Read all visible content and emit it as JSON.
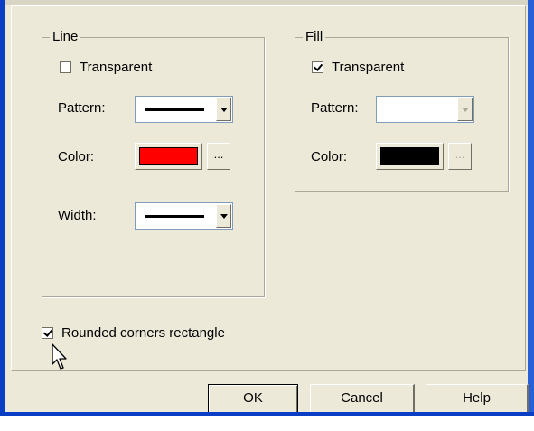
{
  "line_group": {
    "title": "Line",
    "transparent_label": "Transparent",
    "transparent_checked": false,
    "pattern_label": "Pattern:",
    "color_label": "Color:",
    "color_value": "#ff0000",
    "color_more": "...",
    "width_label": "Width:"
  },
  "fill_group": {
    "title": "Fill",
    "transparent_label": "Transparent",
    "transparent_checked": true,
    "pattern_label": "Pattern:",
    "color_label": "Color:",
    "color_value": "#000000",
    "color_more": "..."
  },
  "rounded_label": "Rounded corners rectangle",
  "rounded_checked": true,
  "buttons": {
    "ok": "OK",
    "cancel": "Cancel",
    "help": "Help"
  }
}
